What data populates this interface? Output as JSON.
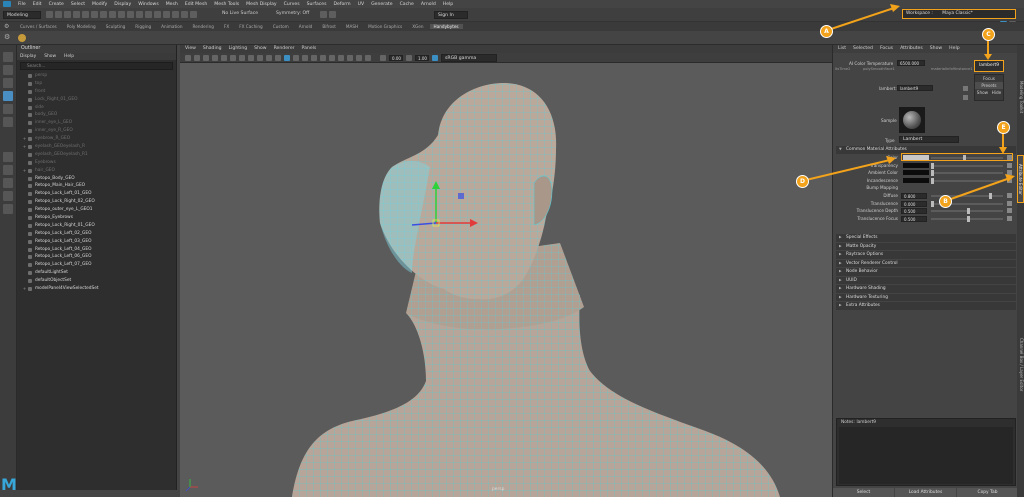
{
  "menubar": [
    "File",
    "Edit",
    "Create",
    "Select",
    "Modify",
    "Display",
    "Windows",
    "Mesh",
    "Edit Mesh",
    "Mesh Tools",
    "Mesh Display",
    "Curves",
    "Surfaces",
    "Deform",
    "UV",
    "Generate",
    "Cache",
    "Arnold",
    "Help"
  ],
  "toolrow": {
    "mode": "Modeling",
    "live_surface": "No Live Surface",
    "symmetry": "Symmetry: Off",
    "sign_in": "Sign In",
    "workspace_label": "Workspace :",
    "workspace_value": "Maya Classic*"
  },
  "shelf_tabs": [
    "Curves / Surfaces",
    "Poly Modeling",
    "Sculpting",
    "Rigging",
    "Animation",
    "Rendering",
    "FX",
    "FX Caching",
    "Custom",
    "Arnold",
    "Bifrost",
    "MASH",
    "Motion Graphics",
    "XGen",
    "Handybytes"
  ],
  "shelf_active": "Handybytes",
  "outliner": {
    "title": "Outliner",
    "menu": [
      "Display",
      "Show",
      "Help"
    ],
    "search_placeholder": "Search...",
    "items": [
      {
        "label": "persp",
        "style": "dim",
        "expand": ""
      },
      {
        "label": "top",
        "style": "dim",
        "expand": ""
      },
      {
        "label": "front",
        "style": "dim",
        "expand": ""
      },
      {
        "label": "Lock_Right_01_GEO",
        "style": "dim",
        "expand": ""
      },
      {
        "label": "side",
        "style": "dim",
        "expand": ""
      },
      {
        "label": "body_GEO",
        "style": "dim",
        "expand": ""
      },
      {
        "label": "inner_eye_L_GEO",
        "style": "dim",
        "expand": ""
      },
      {
        "label": "inner_eye_R_GEO",
        "style": "dim",
        "expand": ""
      },
      {
        "label": "eyebrow_R_GEO",
        "style": "dim",
        "expand": "+"
      },
      {
        "label": "eyelash_GEOeyelash_R",
        "style": "dim",
        "expand": "+"
      },
      {
        "label": "eyelash_GEOeyelash_R1",
        "style": "dim",
        "expand": ""
      },
      {
        "label": "Eyebrows",
        "style": "dim",
        "expand": ""
      },
      {
        "label": "hair_GEO",
        "style": "dim",
        "expand": "+"
      },
      {
        "label": "Retopo_Body_GEO",
        "style": "bright",
        "expand": ""
      },
      {
        "label": "Retopo_Main_Hair_GEO",
        "style": "bright",
        "expand": ""
      },
      {
        "label": "Retopo_Lock_Left_01_GEO",
        "style": "bright",
        "expand": ""
      },
      {
        "label": "Retopo_Lock_Right_02_GEO",
        "style": "bright",
        "expand": ""
      },
      {
        "label": "Retopo_outer_eye_L_GEO1",
        "style": "bright",
        "expand": ""
      },
      {
        "label": "Retopo_Eyebrows",
        "style": "bright",
        "expand": ""
      },
      {
        "label": "Retopo_Lock_Right_01_GEO",
        "style": "bright",
        "expand": ""
      },
      {
        "label": "Retopo_Lock_Left_02_GEO",
        "style": "bright",
        "expand": ""
      },
      {
        "label": "Retopo_Lock_Left_03_GEO",
        "style": "bright",
        "expand": ""
      },
      {
        "label": "Retopo_Lock_Left_04_GEO",
        "style": "bright",
        "expand": ""
      },
      {
        "label": "Retopo_Lock_Left_06_GEO",
        "style": "bright",
        "expand": ""
      },
      {
        "label": "Retopo_Lock_Left_07_GEO",
        "style": "bright",
        "expand": ""
      },
      {
        "label": "defaultLightSet",
        "style": "bright",
        "expand": ""
      },
      {
        "label": "defaultObjectSet",
        "style": "bright",
        "expand": ""
      },
      {
        "label": "modelPanel4ViewSelectedSet",
        "style": "bright",
        "expand": "+"
      }
    ]
  },
  "viewport": {
    "menu": [
      "View",
      "Shading",
      "Lighting",
      "Show",
      "Renderer",
      "Panels"
    ],
    "exposure": "0.00",
    "gamma": "1.00",
    "color_space": "sRGB gamma",
    "camera_label": "persp"
  },
  "attribute_editor": {
    "menu": [
      "List",
      "Selected",
      "Focus",
      "Attributes",
      "Show",
      "Help"
    ],
    "top_tabs": [
      "ltsTime2",
      "polySmoothFace1",
      "materialInfo9Instance1"
    ],
    "ai_color_temp_label": "AI Color Temperature",
    "ai_color_temp_value": "6500.000",
    "node_name": "lambert9",
    "node_field_label": "lambert:",
    "node_field_value": "lambert9",
    "popup_buttons": [
      "Focus",
      "Presets",
      "Show",
      "Hide"
    ],
    "sample_label": "Sample",
    "type_label": "Type",
    "type_value": "Lambert",
    "common_section": "Common Material Attributes",
    "attrs": [
      {
        "label": "Color",
        "value": "",
        "kind": "color"
      },
      {
        "label": "Transparency",
        "value": "",
        "kind": "black"
      },
      {
        "label": "Ambient Color",
        "value": "",
        "kind": "black"
      },
      {
        "label": "Incandescence",
        "value": "",
        "kind": "black"
      },
      {
        "label": "Bump Mapping",
        "value": "",
        "kind": "none"
      },
      {
        "label": "Diffuse",
        "value": "0.800",
        "kind": "num"
      },
      {
        "label": "Translucence",
        "value": "0.000",
        "kind": "num"
      },
      {
        "label": "Translucence Depth",
        "value": "0.500",
        "kind": "num"
      },
      {
        "label": "Translucence Focus",
        "value": "0.500",
        "kind": "num"
      }
    ],
    "sections": [
      "Special Effects",
      "Matte Opacity",
      "Raytrace Options",
      "Vector Renderer Control",
      "Node Behavior",
      "UUID",
      "Hardware Shading",
      "Hardware Texturing",
      "Extra Attributes"
    ],
    "notes_label": "Notes:",
    "notes_value": "lambert9",
    "bottom_buttons": [
      "Select",
      "Load Attributes",
      "Copy Tab"
    ]
  },
  "right_strip_tabs": [
    "Attribute Editor",
    "Channel Box / Layer Editor",
    "Modeling Toolkit"
  ],
  "callouts": [
    "A",
    "B",
    "C",
    "D",
    "E"
  ],
  "logo_letter": "M",
  "colors": {
    "accent": "#f2a31b",
    "wire": "#44d7e8",
    "skin": "#b7a597"
  }
}
